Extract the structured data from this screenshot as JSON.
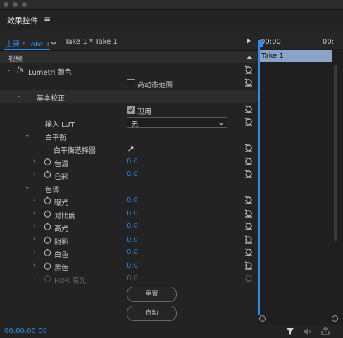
{
  "panel": {
    "title": "效果控件",
    "menu_icon": "hamburger-icon"
  },
  "clip_tabs": {
    "main": "主要 * Take 1",
    "sequence": "Take 1 * Take 1"
  },
  "timeline": {
    "time_start": "00:00",
    "time_end": "00:",
    "clip_name": "Take 1"
  },
  "sections": {
    "video": "视频"
  },
  "effect": {
    "fx_label": "fx",
    "name": "Lumetri 颜色",
    "hdr_label": "高动态范围"
  },
  "basic": {
    "title": "基本校正",
    "apply_label": "现用",
    "lut_label": "输入 LUT",
    "lut_value": "无",
    "wb_title": "白平衡",
    "wb_selector": "白平衡选择器",
    "temperature": {
      "label": "色温",
      "value": "0.0"
    },
    "tint": {
      "label": "色彩",
      "value": "0.0"
    }
  },
  "tone": {
    "title": "色调",
    "params": [
      {
        "label": "曝光",
        "value": "0.0"
      },
      {
        "label": "对比度",
        "value": "0.0"
      },
      {
        "label": "高光",
        "value": "0.0"
      },
      {
        "label": "阴影",
        "value": "0.0"
      },
      {
        "label": "白色",
        "value": "0.0"
      },
      {
        "label": "黑色",
        "value": "0.0"
      }
    ],
    "hdr_highlight": {
      "label": "HDR 高光",
      "value": "0.0"
    }
  },
  "buttons": {
    "reset": "重置",
    "auto": "自动"
  },
  "footer": {
    "timecode": "00:00:00:00"
  },
  "colors": {
    "accent": "#2d8ceb",
    "clip": "#8aa4c8",
    "background": "#232323"
  }
}
